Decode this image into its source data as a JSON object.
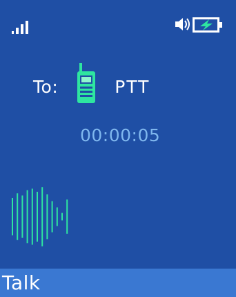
{
  "status_bar": {
    "signal_icon": "signal-bars-icon",
    "speaker_icon": "speaker-icon",
    "battery_icon": "battery-charging-icon"
  },
  "call": {
    "to_label": "To:",
    "target_icon": "walkie-talkie-icon",
    "target_name": "PTT",
    "timer": "00:00:05"
  },
  "voice_meter": {
    "levels": [
      0.6,
      0.75,
      0.68,
      0.85,
      0.9,
      0.8,
      0.95,
      0.72,
      0.5,
      0.3,
      0.12,
      0.55
    ]
  },
  "softkeys": {
    "left_label": "Talk"
  },
  "colors": {
    "background": "#1f4fa5",
    "softkey_bar": "#3a78d2",
    "accent_green": "#2ee6a0",
    "timer_text": "#7fb7ee"
  }
}
